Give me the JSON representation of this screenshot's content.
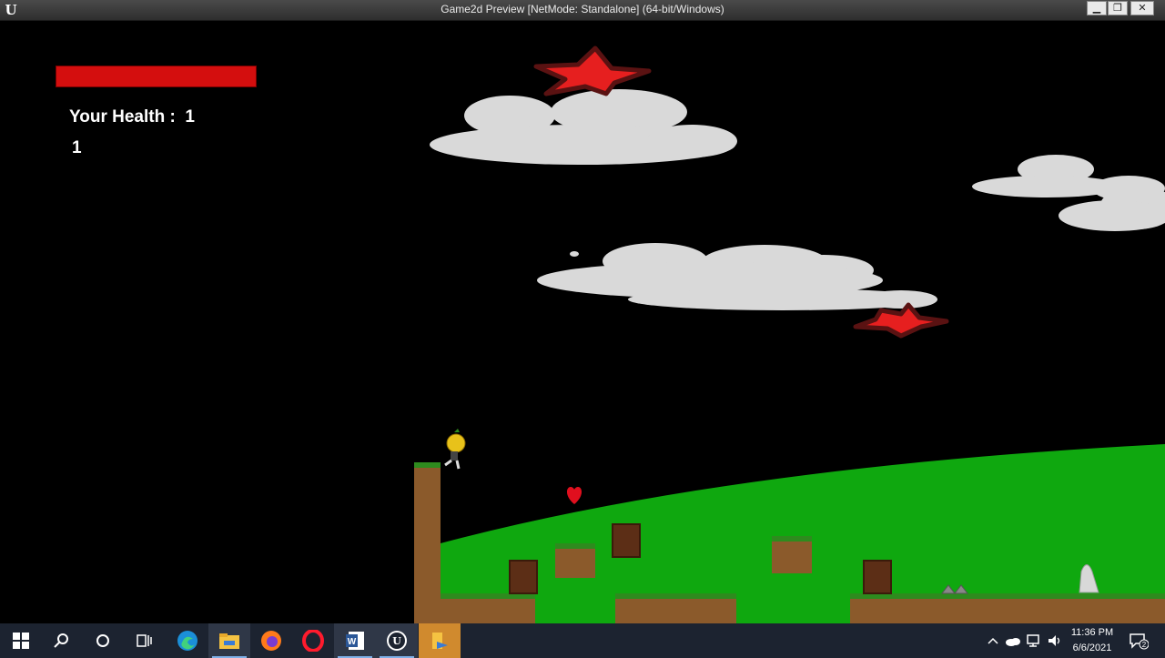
{
  "window": {
    "title": "Game2d Preview [NetMode: Standalone] (64-bit/Windows)",
    "logo_glyph": "U",
    "buttons": {
      "minimize": "▁",
      "maximize": "❐",
      "close": "✕"
    }
  },
  "hud": {
    "health_bar_fraction": 1.0,
    "health_label": "Your Health :  1",
    "counter": "1",
    "health_bar_color": "#d40e0e"
  },
  "scene": {
    "background_color": "#000000",
    "hill_color": "#0fa80f",
    "ground_color": "#8b5a2b",
    "grass_color": "#2e8b1e",
    "star_color": "#e61f1f",
    "cloud_color": "#d9d9d9"
  },
  "taskbar": {
    "apps": [
      "start-icon",
      "search-icon",
      "cortana-icon",
      "task-view-icon",
      "edge-icon",
      "file-explorer-icon",
      "firefox-icon",
      "opera-icon",
      "word-icon",
      "unreal-engine-icon",
      "game-window-icon"
    ],
    "time": "11:36 PM",
    "date": "6/6/2021",
    "notification_count": "2"
  }
}
